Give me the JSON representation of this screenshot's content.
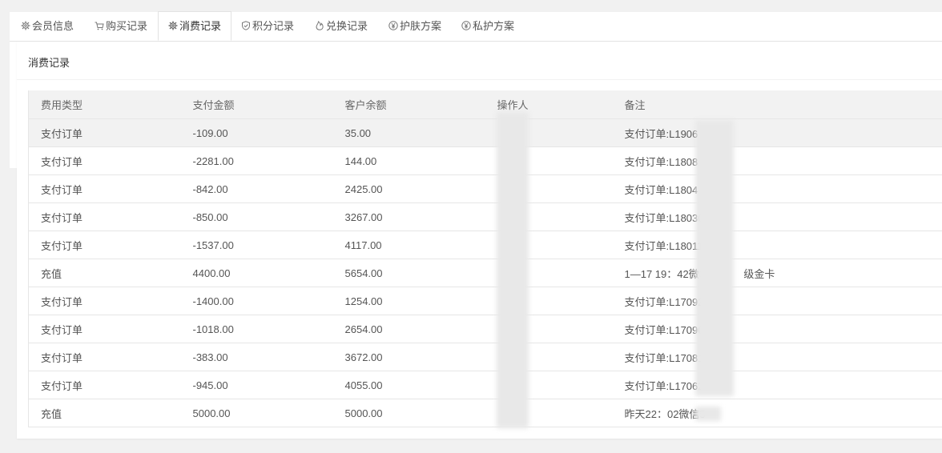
{
  "tabs": [
    {
      "label": "会员信息",
      "icon": "gear-icon"
    },
    {
      "label": "购买记录",
      "icon": "cart-icon"
    },
    {
      "label": "消费记录",
      "icon": "gear-icon",
      "active": true
    },
    {
      "label": "积分记录",
      "icon": "shield-icon"
    },
    {
      "label": "兑换记录",
      "icon": "flame-icon"
    },
    {
      "label": "护肤方案",
      "icon": "yen-icon"
    },
    {
      "label": "私护方案",
      "icon": "yen-icon"
    }
  ],
  "panel": {
    "title": "消费记录"
  },
  "table": {
    "headers": [
      "费用类型",
      "支付金额",
      "客户余额",
      "操作人",
      "备注"
    ],
    "rows": [
      {
        "type": "支付订单",
        "amount": "-109.00",
        "balance": "35.00",
        "operator": "",
        "note": "支付订单:L1906"
      },
      {
        "type": "支付订单",
        "amount": "-2281.00",
        "balance": "144.00",
        "operator": "",
        "note": "支付订单:L1808"
      },
      {
        "type": "支付订单",
        "amount": "-842.00",
        "balance": "2425.00",
        "operator": "",
        "note": "支付订单:L1804"
      },
      {
        "type": "支付订单",
        "amount": "-850.00",
        "balance": "3267.00",
        "operator": "",
        "note": "支付订单:L18030"
      },
      {
        "type": "支付订单",
        "amount": "-1537.00",
        "balance": "4117.00",
        "operator": "",
        "note": "支付订单:L1801180"
      },
      {
        "type": "充值",
        "amount": "4400.00",
        "balance": "5654.00",
        "operator": "",
        "note": "1—17 19：42微380"
      },
      {
        "type": "支付订单",
        "amount": "-1400.00",
        "balance": "1254.00",
        "operator": "",
        "note": "支付订单:L17092601"
      },
      {
        "type": "支付订单",
        "amount": "-1018.00",
        "balance": "2654.00",
        "operator": "",
        "note": "支付订单:L1709020"
      },
      {
        "type": "支付订单",
        "amount": "-383.00",
        "balance": "3672.00",
        "operator": "",
        "note": "支付订单:L170812"
      },
      {
        "type": "支付订单",
        "amount": "-945.00",
        "balance": "4055.00",
        "operator": "",
        "note": "支付订单:L17062"
      },
      {
        "type": "充值",
        "amount": "5000.00",
        "balance": "5000.00",
        "operator": "",
        "note": "昨天22：02微信5"
      }
    ],
    "row5_note_tail": "级金卡"
  }
}
